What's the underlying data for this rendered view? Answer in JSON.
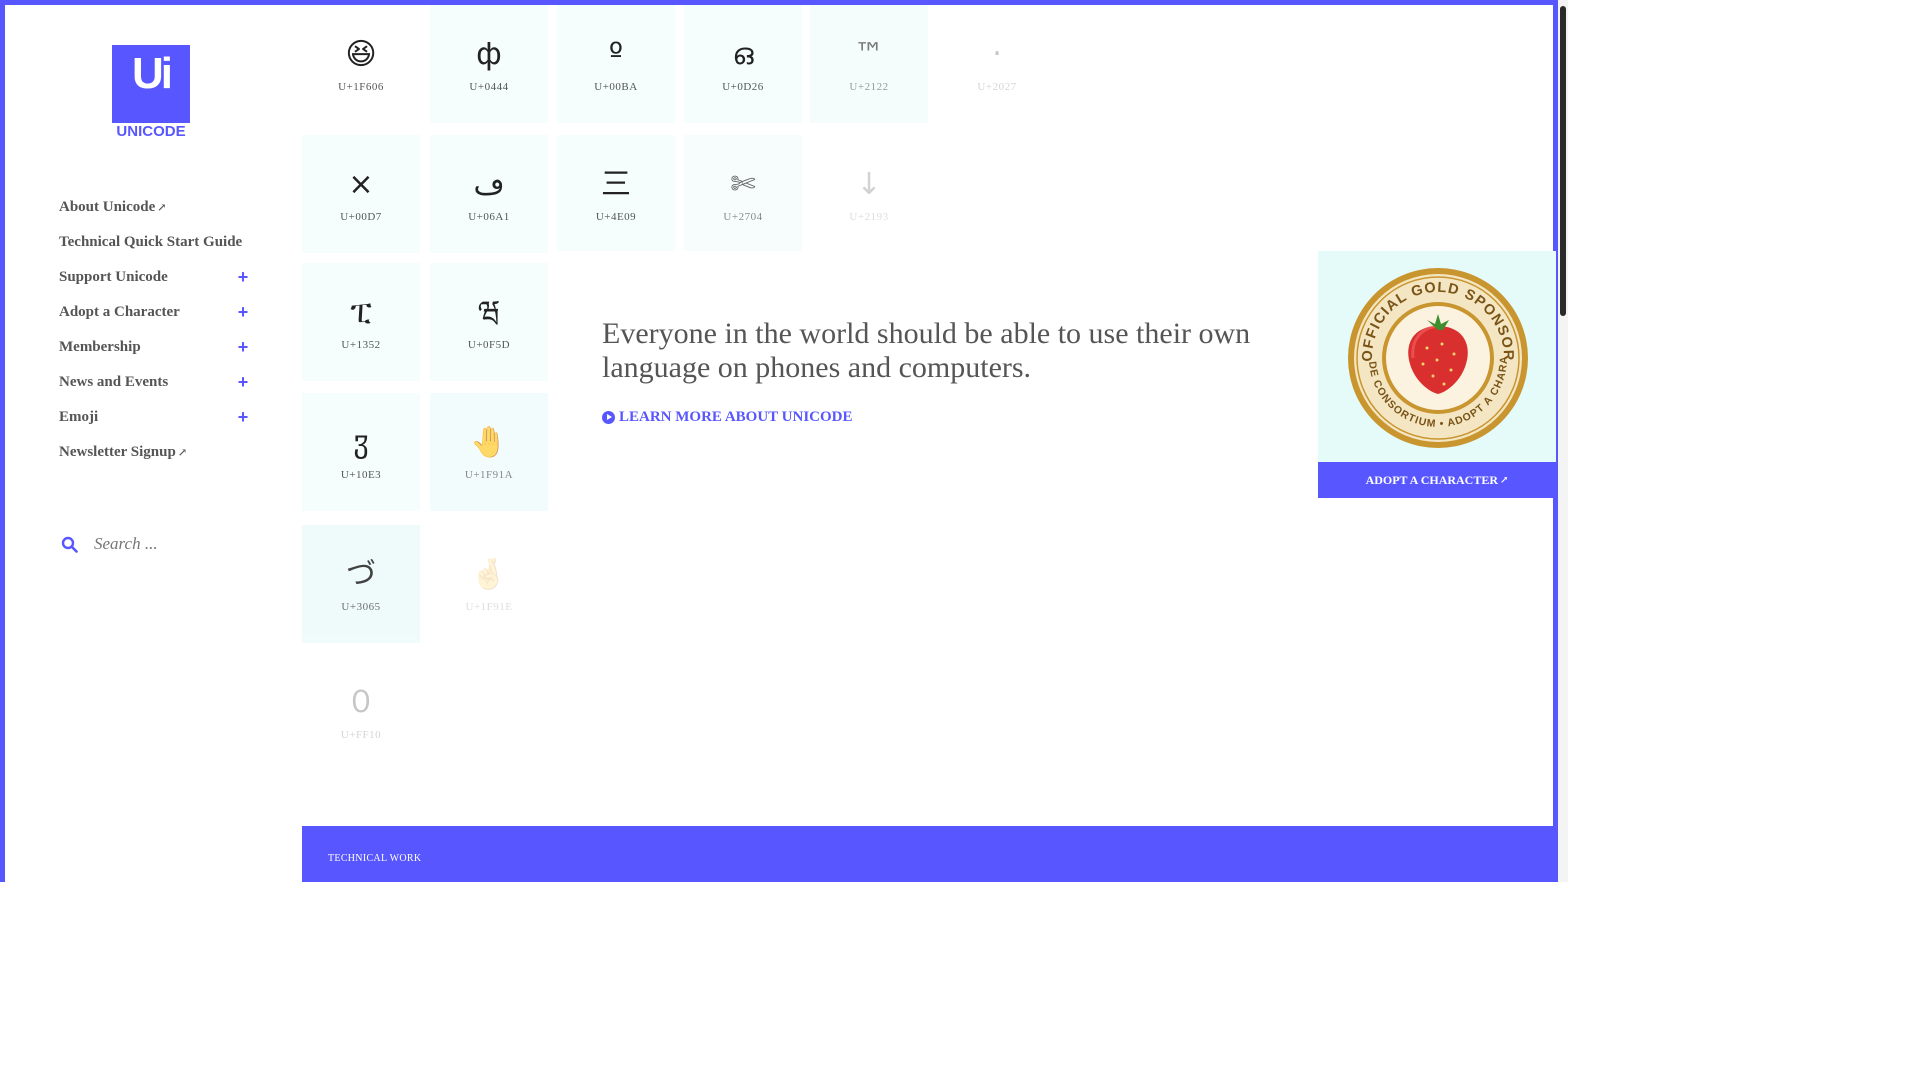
{
  "logo": {
    "mark": "Ui",
    "wordmark": "UNICODE"
  },
  "nav": [
    {
      "label": "About Unicode",
      "external": true,
      "expandable": false
    },
    {
      "label": "Technical Quick Start Guide",
      "external": false,
      "expandable": false
    },
    {
      "label": "Support Unicode",
      "external": false,
      "expandable": true
    },
    {
      "label": "Adopt a Character",
      "external": false,
      "expandable": true
    },
    {
      "label": "Membership",
      "external": false,
      "expandable": true
    },
    {
      "label": "News and Events",
      "external": false,
      "expandable": true
    },
    {
      "label": "Emoji",
      "external": false,
      "expandable": true
    },
    {
      "label": "Newsletter Signup",
      "external": true,
      "expandable": false
    }
  ],
  "nav_symbols": {
    "external": "↗",
    "expand": "+"
  },
  "search": {
    "placeholder": "Search ..."
  },
  "characters": [
    {
      "glyph": "😆",
      "code": "U+1F606"
    },
    {
      "glyph": "ф",
      "code": "U+0444"
    },
    {
      "glyph": "º",
      "code": "U+00BA"
    },
    {
      "glyph": "ഒ",
      "code": "U+0D26"
    },
    {
      "glyph": "™",
      "code": "U+2122"
    },
    {
      "glyph": "‧",
      "code": "U+2027"
    },
    {
      "glyph": "×",
      "code": "U+00D7"
    },
    {
      "glyph": "ڡ",
      "code": "U+06A1"
    },
    {
      "glyph": "三",
      "code": "U+4E09"
    },
    {
      "glyph": "✄",
      "code": "U+2704"
    },
    {
      "glyph": "↓",
      "code": "U+2193"
    },
    {
      "glyph": "ፒ",
      "code": "U+1352"
    },
    {
      "glyph": "ཝ",
      "code": "U+0F5D"
    },
    {
      "glyph": "ჳ",
      "code": "U+10E3"
    },
    {
      "glyph": "🤚",
      "code": "U+1F91A"
    },
    {
      "glyph": "づ",
      "code": "U+3065"
    },
    {
      "glyph": "🤞",
      "code": "U+1F91E"
    },
    {
      "glyph": "０",
      "code": "U+FF10"
    }
  ],
  "hero": {
    "headline": "Everyone in the world should be able to use their own language on phones and computers.",
    "link_label": "LEARN MORE ABOUT UNICODE"
  },
  "sponsor": {
    "badge_top": "OFFICIAL GOLD SPONSOR",
    "badge_bottom": "UNICODE CONSORTIUM • ADOPT A CHARACTER",
    "badge_icon": "strawberry-icon",
    "button_label": "ADOPT A CHARACTER"
  },
  "footer": {
    "label": "TECHNICAL WORK"
  },
  "colors": {
    "accent": "#5856ff",
    "tile_bg": "#e4fbfa",
    "text": "#555555"
  }
}
